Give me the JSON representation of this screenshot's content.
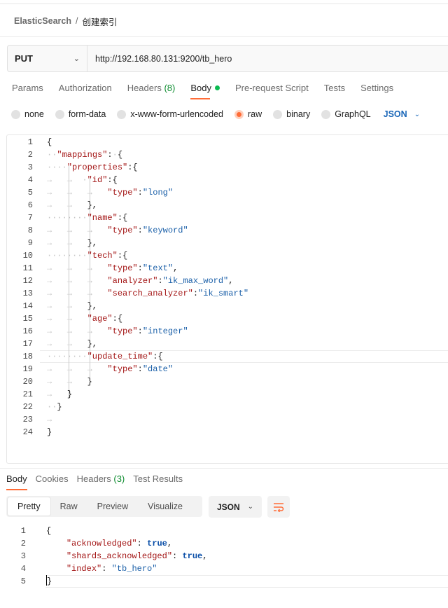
{
  "breadcrumb": {
    "collection": "ElasticSearch",
    "separator": "/",
    "request": "创建索引"
  },
  "request": {
    "method": "PUT",
    "url": "http://192.168.80.131:9200/tb_hero"
  },
  "tabs": [
    {
      "label": "Params"
    },
    {
      "label": "Authorization"
    },
    {
      "label": "Headers",
      "count": "(8)"
    },
    {
      "label": "Body",
      "active": true
    },
    {
      "label": "Pre-request Script"
    },
    {
      "label": "Tests"
    },
    {
      "label": "Settings"
    }
  ],
  "body_types": {
    "options": [
      "none",
      "form-data",
      "x-www-form-urlencoded",
      "raw",
      "binary",
      "GraphQL"
    ],
    "selected": "raw",
    "language": "JSON"
  },
  "request_body": {
    "line_numbers": [
      "1",
      "2",
      "3",
      "4",
      "5",
      "6",
      "7",
      "8",
      "9",
      "10",
      "11",
      "12",
      "13",
      "14",
      "15",
      "16",
      "17",
      "18",
      "19",
      "20",
      "21",
      "22",
      "23",
      "24"
    ]
  },
  "response": {
    "tabs": [
      {
        "label": "Body",
        "active": true
      },
      {
        "label": "Cookies"
      },
      {
        "label": "Headers",
        "count": "(3)"
      },
      {
        "label": "Test Results"
      }
    ],
    "views": [
      "Pretty",
      "Raw",
      "Preview",
      "Visualize"
    ],
    "active_view": "Pretty",
    "format": "JSON",
    "line_numbers": [
      "1",
      "2",
      "3",
      "4",
      "5"
    ],
    "fields": {
      "acknowledged_key": "\"acknowledged\"",
      "acknowledged_val": "true",
      "shards_key": "\"shards_acknowledged\"",
      "shards_val": "true",
      "index_key": "\"index\"",
      "index_val": "\"tb_hero\""
    }
  },
  "colors": {
    "accent": "#ff6c37",
    "link": "#1a67b8",
    "success": "#0cbb52"
  }
}
